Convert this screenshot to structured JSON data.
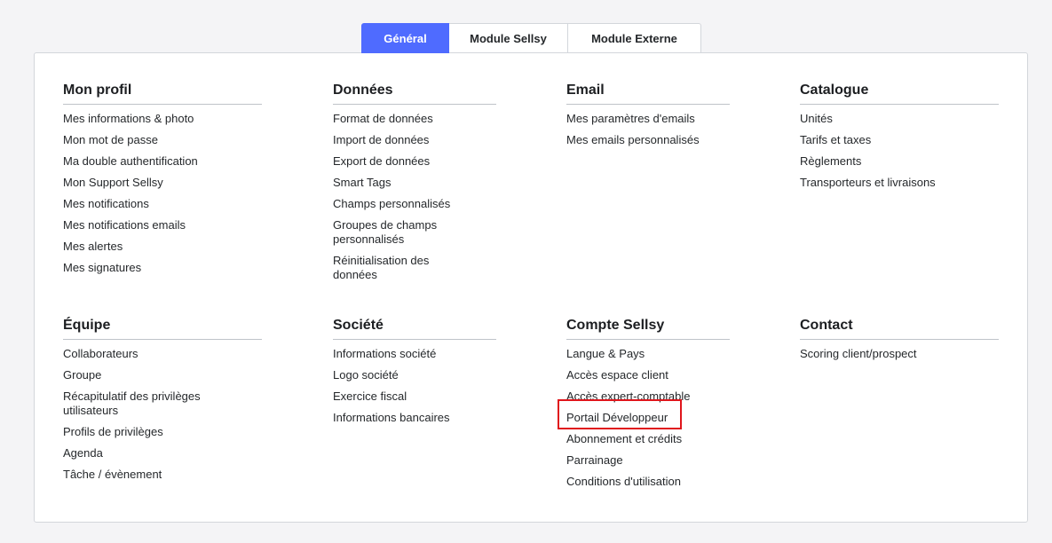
{
  "tabs": [
    {
      "label": "Général",
      "active": true
    },
    {
      "label": "Module Sellsy",
      "active": false
    },
    {
      "label": "Module Externe",
      "active": false
    }
  ],
  "sections": {
    "mon_profil": {
      "title": "Mon profil",
      "items": [
        "Mes informations & photo",
        "Mon mot de passe",
        "Ma double authentification",
        "Mon Support Sellsy",
        "Mes notifications",
        "Mes notifications emails",
        "Mes alertes",
        "Mes signatures"
      ]
    },
    "donnees": {
      "title": "Données",
      "items": [
        "Format de données",
        "Import de données",
        "Export de données",
        "Smart Tags",
        "Champs personnalisés",
        "Groupes de champs personnalisés",
        "Réinitialisation des données"
      ]
    },
    "email": {
      "title": "Email",
      "items": [
        "Mes paramètres d'emails",
        "Mes emails personnalisés"
      ]
    },
    "catalogue": {
      "title": "Catalogue",
      "items": [
        "Unités",
        "Tarifs et taxes",
        "Règlements",
        "Transporteurs et livraisons"
      ]
    },
    "equipe": {
      "title": "Équipe",
      "items": [
        "Collaborateurs",
        "Groupe",
        "Récapitulatif des privilèges utilisateurs",
        "Profils de privilèges",
        "Agenda",
        "Tâche / évènement"
      ]
    },
    "societe": {
      "title": "Société",
      "items": [
        "Informations société",
        "Logo société",
        "Exercice fiscal",
        "Informations bancaires"
      ]
    },
    "compte_sellsy": {
      "title": "Compte Sellsy",
      "items": [
        "Langue & Pays",
        "Accès espace client",
        "Accès expert-comptable",
        "Portail Développeur",
        "Abonnement et crédits",
        "Parrainage",
        "Conditions d'utilisation"
      ]
    },
    "contact": {
      "title": "Contact",
      "items": [
        "Scoring client/prospect"
      ]
    }
  },
  "colors": {
    "accent": "#4f6bff",
    "highlight": "#e0161c"
  }
}
